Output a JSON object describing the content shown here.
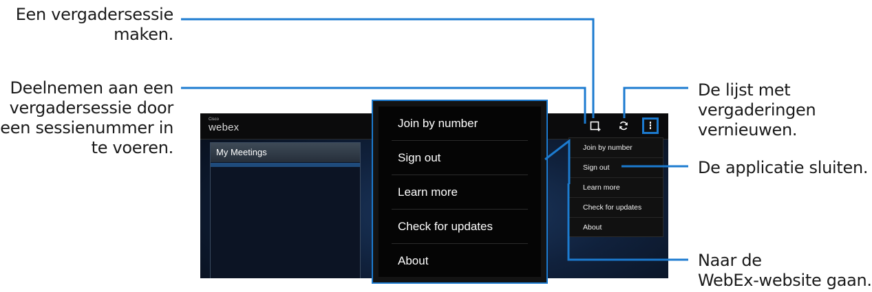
{
  "callouts": {
    "create_meeting": [
      "Een vergadersessie",
      "maken."
    ],
    "join_meeting": [
      "Deelnemen aan een",
      "vergadersessie door",
      "een sessienummer in",
      "te voeren."
    ],
    "refresh_list": [
      "De lijst met",
      "vergaderingen",
      "vernieuwen."
    ],
    "close_app": [
      "De applicatie sluiten."
    ],
    "go_website": [
      "Naar de",
      "WebEx-website gaan."
    ]
  },
  "app": {
    "logo_small": "Cisco",
    "logo_big": "webex",
    "panel_title": "My Meetings",
    "icons": [
      "add-meeting-icon",
      "refresh-icon",
      "overflow-menu-icon"
    ]
  },
  "menu": {
    "items": [
      "Join by number",
      "Sign out",
      "Learn more",
      "Check for updates",
      "About"
    ]
  },
  "colors": {
    "callout_line": "#1c7bd0",
    "callout_text": "#1a1a1a",
    "app_topbar": "#0b0b0c",
    "panel_accent": "#1f4b7c"
  }
}
